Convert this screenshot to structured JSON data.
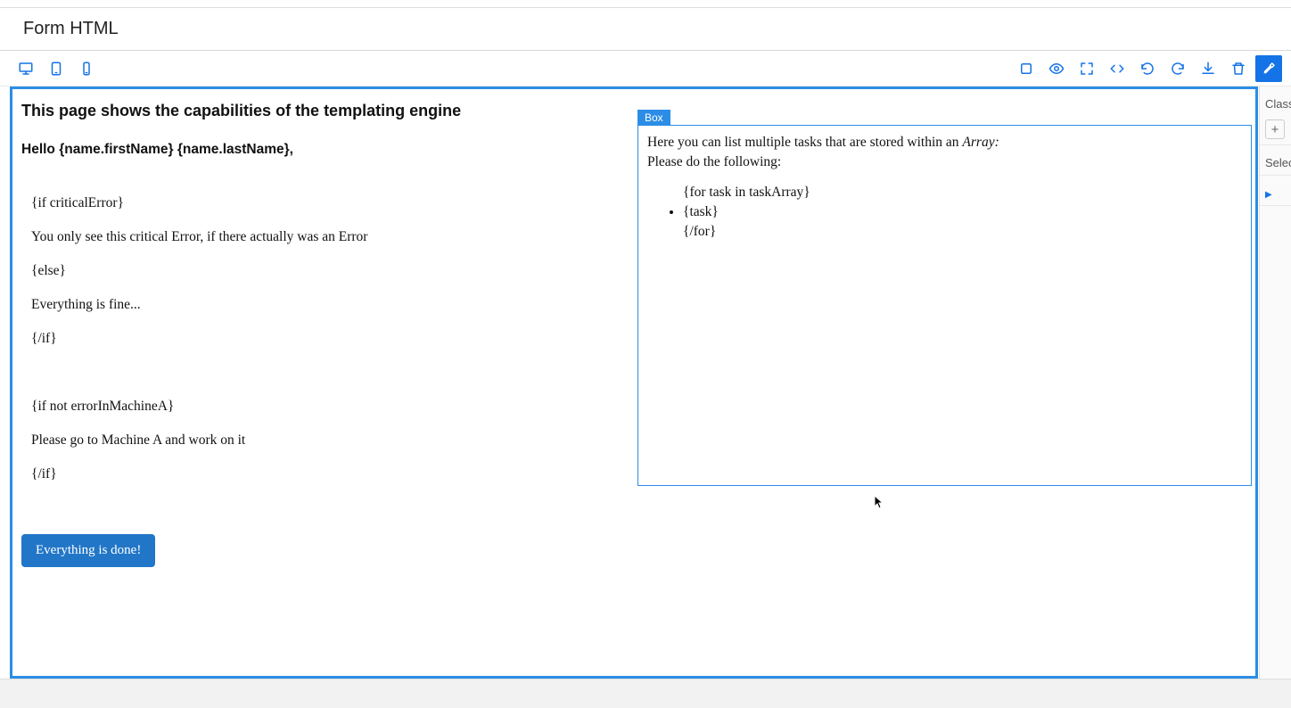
{
  "header": {
    "title": "Form HTML"
  },
  "toolbar": {
    "left": [
      {
        "name": "desktop-icon"
      },
      {
        "name": "tablet-icon"
      },
      {
        "name": "mobile-icon"
      }
    ],
    "right": [
      {
        "name": "border-icon"
      },
      {
        "name": "preview-icon"
      },
      {
        "name": "fullscreen-icon"
      },
      {
        "name": "code-icon"
      },
      {
        "name": "undo-icon"
      },
      {
        "name": "redo-icon"
      },
      {
        "name": "download-icon"
      },
      {
        "name": "trash-icon"
      },
      {
        "name": "brush-icon"
      }
    ]
  },
  "canvas": {
    "page_title": "This page shows the capabilities of the templating engine",
    "greeting": "Hello {name.firstName} {name.lastName},",
    "block1": [
      "{if criticalError}",
      "You only see this critical Error, if there actually was an Error",
      "{else}",
      "Everything is fine...",
      "{/if}"
    ],
    "block2": [
      "{if not errorInMachineA}",
      "Please go to Machine A and work on it",
      "{/if}"
    ],
    "done_button": "Everything is done!",
    "box": {
      "tag": "Box",
      "intro_prefix": "Here you can list multiple tasks that are stored within an ",
      "intro_em": "Array:",
      "subintro": "Please do the following:",
      "items": [
        "{for task in taskArray}",
        "{task}",
        "{/for}"
      ]
    }
  },
  "right_panel": {
    "classes_label": "Class",
    "selection_label": "Selec"
  }
}
